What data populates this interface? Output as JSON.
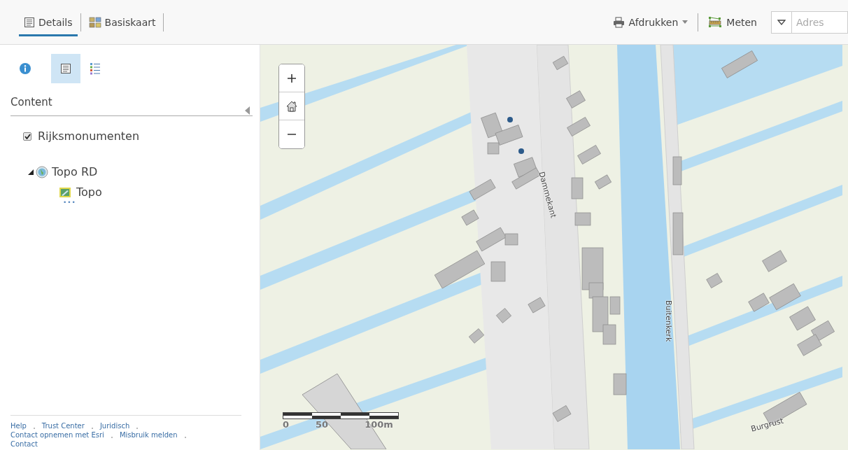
{
  "tabs": [
    {
      "label": "Details",
      "kind": "details",
      "selected": true
    },
    {
      "label": "Basiskaart",
      "kind": "basemap",
      "selected": false
    }
  ],
  "toolbar": {
    "print_label": "Afdrukken",
    "measure_label": "Meten",
    "search": {
      "placeholder": "Adres"
    }
  },
  "sidebar": {
    "panel_tabs": [
      {
        "kind": "info",
        "selected": false
      },
      {
        "kind": "content",
        "selected": true
      },
      {
        "kind": "legend",
        "selected": false
      }
    ],
    "heading": "Content",
    "layers": [
      {
        "label": "Rijksmonumenten",
        "checked": true
      }
    ],
    "tree": [
      {
        "label": "Topo RD",
        "kind": "group",
        "expanded": true,
        "children": [
          {
            "label": "Topo",
            "kind": "tile"
          }
        ]
      }
    ],
    "more_label": "•••",
    "footer_links": [
      "Help",
      "Trust Center",
      "Juridisch",
      "Contact opnemen met Esri",
      "Misbruik melden",
      "Contact"
    ]
  },
  "map": {
    "labels": [
      "Dammekant",
      "Buitenkerk",
      "Burgrust"
    ],
    "scale_labels": [
      "0",
      "50",
      "100m"
    ]
  }
}
